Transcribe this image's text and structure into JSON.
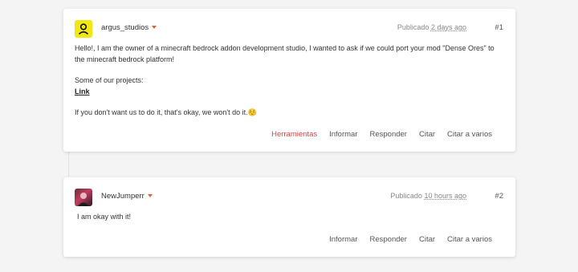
{
  "posts": [
    {
      "username": "argus_studios",
      "published_label": "Publicado",
      "time_ago": "2 days ago",
      "number": "#1",
      "body_line1": "Hello!, I am the owner of a minecraft bedrock addon development studio, I wanted to ask if we could port your mod \"Dense Ores\" to the minecraft bedrock platform!",
      "body_line2": "Some of our projects:",
      "link_text": "Link",
      "body_line3": "If you don't want us to do it, that's okay, we won't do it.☺️",
      "actions": [
        "Herramientas",
        "Informar",
        "Responder",
        "Citar",
        "Citar a varios"
      ]
    },
    {
      "username": "NewJumperr",
      "published_label": "Publicado",
      "time_ago": "10 hours ago",
      "number": "#2",
      "body_line1": "I am okay with it!",
      "actions": [
        "Informar",
        "Responder",
        "Citar",
        "Citar a varios"
      ]
    }
  ],
  "colors": {
    "accent": "#e0603a",
    "tools": "#d64545",
    "avatar1": "#f2e614"
  },
  "icons": {
    "avatar1": "person-icon",
    "caret": "caret-down-icon"
  }
}
